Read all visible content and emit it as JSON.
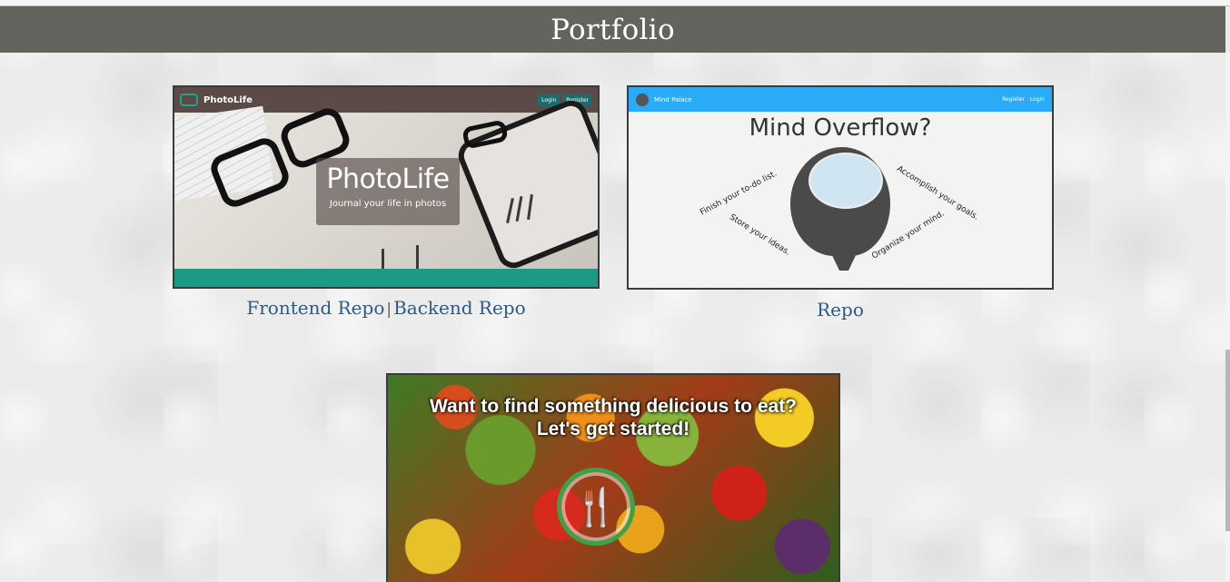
{
  "header": {
    "title": "Portfolio"
  },
  "projects": [
    {
      "id": "photolife",
      "preview": {
        "brand": "PhotoLife",
        "nav_buttons": [
          "Login",
          "Register"
        ],
        "hero_title": "PhotoLife",
        "hero_subtitle": "Journal your life in photos"
      },
      "links": [
        {
          "label": "Frontend Repo"
        },
        {
          "label": "Backend Repo"
        }
      ],
      "separator": "|"
    },
    {
      "id": "mind-palace",
      "preview": {
        "brand": "Mind Palace",
        "nav_links": [
          "Register",
          "Login"
        ],
        "title": "Mind Overflow?",
        "phrases": [
          "Finish your to-do list.",
          "Store your ideas.",
          "Accomplish your goals.",
          "Organize your mind."
        ]
      },
      "links": [
        {
          "label": "Repo"
        }
      ]
    },
    {
      "id": "food-finder",
      "preview": {
        "headline_line1": "Want to find something delicious to eat?",
        "headline_line2": "Let's get started!",
        "logo_icon": "fork-knife-icon"
      }
    }
  ],
  "colors": {
    "header_bg": "#64635e",
    "link": "#2c5a87",
    "photolife_nav": "#5c4a46",
    "photolife_accent": "#1a9a87",
    "mindpalace_nav": "#29abf7",
    "food_logo": "#3aa247"
  }
}
